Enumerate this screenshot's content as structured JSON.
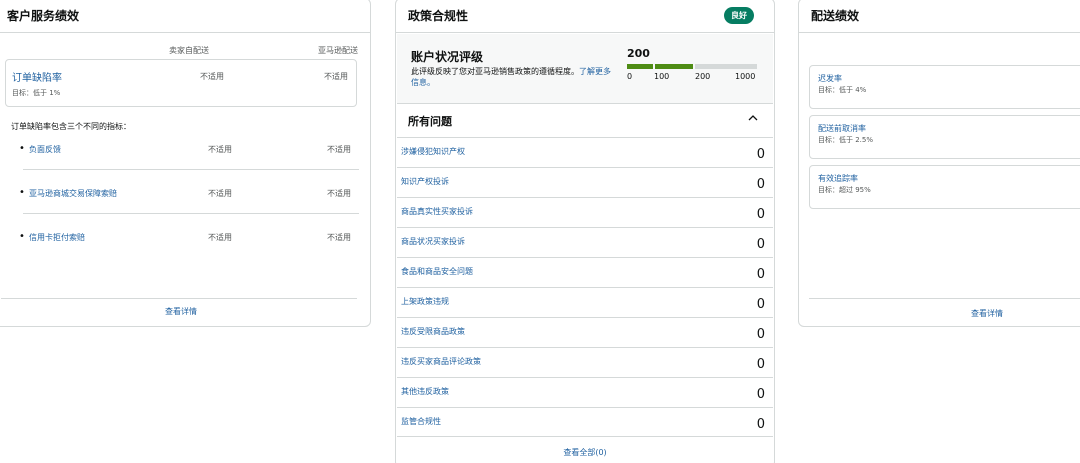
{
  "customer_service": {
    "title": "客户服务绩效",
    "col_seller": "卖家自配送",
    "col_amazon": "亚马逊配送",
    "odr": {
      "label": "订单缺陷率",
      "target": "目标：低于 1%",
      "seller": "不适用",
      "amazon": "不适用"
    },
    "includes_text": "订单缺陷率包含三个不同的指标：",
    "metrics": [
      {
        "bullet": "•",
        "label": "负面反馈",
        "seller": "不适用",
        "amazon": "不适用"
      },
      {
        "bullet": "•",
        "label": "亚马逊商城交易保障索赔",
        "seller": "不适用",
        "amazon": "不适用"
      },
      {
        "bullet": "•",
        "label": "信用卡拒付索赔",
        "seller": "不适用",
        "amazon": "不适用"
      }
    ],
    "footer_link": "查看详情"
  },
  "policy": {
    "title": "政策合规性",
    "badge": "良好",
    "health": {
      "title": "账户状况评级",
      "description": "此评级反映了您对亚马逊销售政策的遵循程度。",
      "learn_more": "了解更多信息。",
      "score": "200",
      "scale": [
        "0",
        "100",
        "200",
        "1000"
      ],
      "colors": {
        "good": "#4e8c14",
        "empty": "#d5d9d9"
      }
    },
    "issues_title": "所有问题",
    "issues": [
      {
        "label": "涉嫌侵犯知识产权",
        "count": "0"
      },
      {
        "label": "知识产权投诉",
        "count": "0"
      },
      {
        "label": "商品真实性买家投诉",
        "count": "0"
      },
      {
        "label": "商品状况买家投诉",
        "count": "0"
      },
      {
        "label": "食品和商品安全问题",
        "count": "0"
      },
      {
        "label": "上架政策违规",
        "count": "0"
      },
      {
        "label": "违反受限商品政策",
        "count": "0"
      },
      {
        "label": "违反买家商品评论政策",
        "count": "0"
      },
      {
        "label": "其他违反政策",
        "count": "0"
      },
      {
        "label": "监管合规性",
        "count": "0"
      }
    ],
    "footer_link": "查看全部(0)"
  },
  "shipping": {
    "title": "配送绩效",
    "metrics": [
      {
        "label": "迟发率",
        "target": "目标：低于 4%"
      },
      {
        "label": "配送前取消率",
        "target": "目标：低于 2.5%"
      },
      {
        "label": "有效追踪率",
        "target": "目标：超过 95%"
      }
    ],
    "footer_link": "查看详情"
  }
}
